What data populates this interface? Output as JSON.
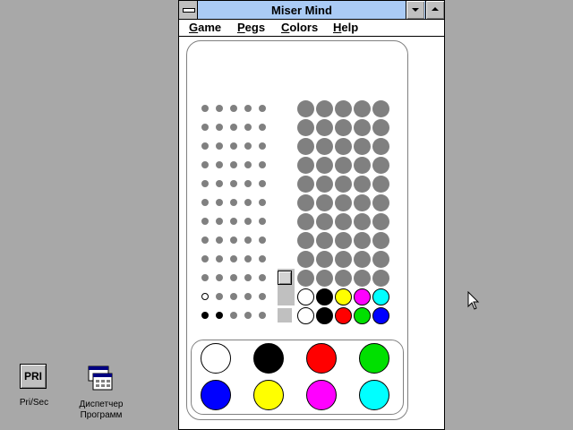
{
  "window": {
    "title": "Miser Mind"
  },
  "menu": [
    {
      "mnemonic": "G",
      "rest": "ame"
    },
    {
      "mnemonic": "P",
      "rest": "egs"
    },
    {
      "mnemonic": "C",
      "rest": "olors"
    },
    {
      "mnemonic": "H",
      "rest": "elp"
    }
  ],
  "colors": {
    "gray": "#808080",
    "white": "#ffffff",
    "black": "#000000",
    "red": "#ff0000",
    "green": "#00e000",
    "blue": "#0000ff",
    "yellow": "#ffff00",
    "magenta": "#ff00ff",
    "cyan": "#00ffff",
    "titlebar": "#aacbf5"
  },
  "board": {
    "rows": 12,
    "guess_rows": [
      [
        "gray",
        "gray",
        "gray",
        "gray",
        "gray"
      ],
      [
        "gray",
        "gray",
        "gray",
        "gray",
        "gray"
      ],
      [
        "gray",
        "gray",
        "gray",
        "gray",
        "gray"
      ],
      [
        "gray",
        "gray",
        "gray",
        "gray",
        "gray"
      ],
      [
        "gray",
        "gray",
        "gray",
        "gray",
        "gray"
      ],
      [
        "gray",
        "gray",
        "gray",
        "gray",
        "gray"
      ],
      [
        "gray",
        "gray",
        "gray",
        "gray",
        "gray"
      ],
      [
        "gray",
        "gray",
        "gray",
        "gray",
        "gray"
      ],
      [
        "gray",
        "gray",
        "gray",
        "gray",
        "gray"
      ],
      [
        "gray",
        "gray",
        "gray",
        "gray",
        "gray"
      ],
      [
        "white",
        "black",
        "yellow",
        "magenta",
        "cyan"
      ],
      [
        "white",
        "black",
        "red",
        "green",
        "blue"
      ]
    ],
    "key_rows": [
      [
        "gray",
        "gray",
        "gray",
        "gray",
        "gray"
      ],
      [
        "gray",
        "gray",
        "gray",
        "gray",
        "gray"
      ],
      [
        "gray",
        "gray",
        "gray",
        "gray",
        "gray"
      ],
      [
        "gray",
        "gray",
        "gray",
        "gray",
        "gray"
      ],
      [
        "gray",
        "gray",
        "gray",
        "gray",
        "gray"
      ],
      [
        "gray",
        "gray",
        "gray",
        "gray",
        "gray"
      ],
      [
        "gray",
        "gray",
        "gray",
        "gray",
        "gray"
      ],
      [
        "gray",
        "gray",
        "gray",
        "gray",
        "gray"
      ],
      [
        "gray",
        "gray",
        "gray",
        "gray",
        "gray"
      ],
      [
        "gray",
        "gray",
        "gray",
        "gray",
        "gray"
      ],
      [
        "white",
        "gray",
        "gray",
        "gray",
        "gray"
      ],
      [
        "black",
        "black",
        "gray",
        "gray",
        "gray"
      ]
    ]
  },
  "palette": [
    "white",
    "black",
    "red",
    "green",
    "blue",
    "yellow",
    "magenta",
    "cyan"
  ],
  "desktop": {
    "icons": [
      {
        "label": "Pri/Sec",
        "glyph": "PRI",
        "icon": "pri-sec-icon"
      },
      {
        "label": "Диспетчер\nПрограмм",
        "icon": "program-manager-icon"
      }
    ]
  }
}
